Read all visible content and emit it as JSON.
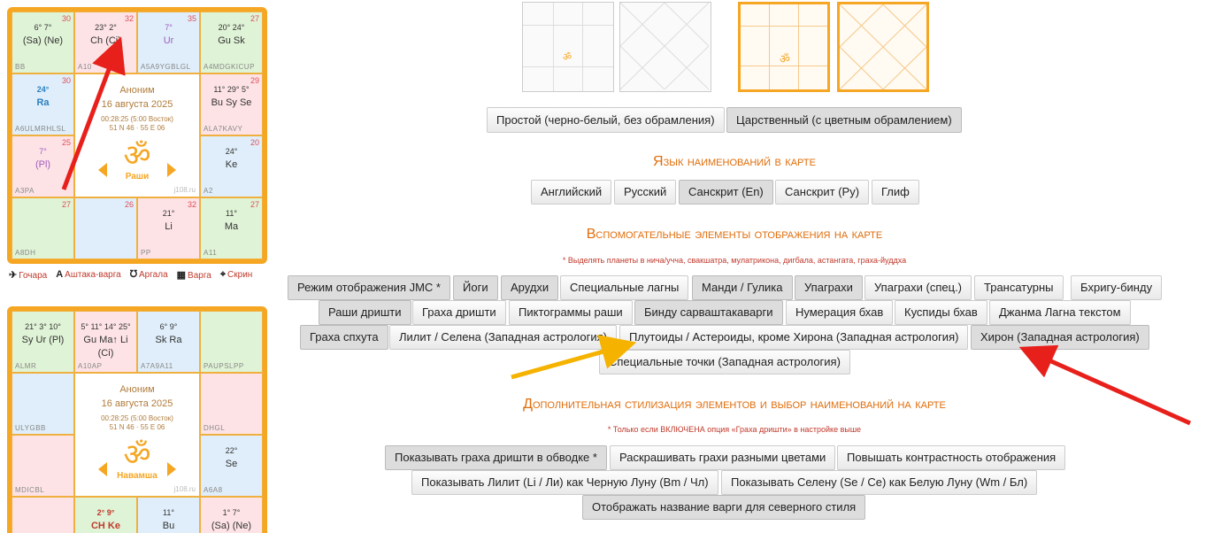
{
  "chart1": {
    "cells": [
      {
        "num": "30",
        "line1": "6° 7°",
        "line2": "(Sa) (Ne)",
        "foot": "BB",
        "bg": "g"
      },
      {
        "num": "32",
        "line1": "23° 2°",
        "line2": "Ch (Ci)",
        "foot": "A10",
        "bg": "p"
      },
      {
        "num": "35",
        "line1": "7°",
        "line2": "Ur",
        "foot": "A5A9YGBLGL",
        "bg": "b"
      },
      {
        "num": "27",
        "line1": "20° 24°",
        "line2": "Gu Sk",
        "foot": "A4MDGKICUP",
        "bg": "g"
      },
      {
        "num": "30",
        "line1": "24°",
        "line2": "Ra",
        "foot": "A6ULMRHLSL",
        "bg": "b"
      },
      {
        "num": "29",
        "line1": "11° 29° 5°",
        "line2": "Bu Sy Se",
        "foot": "ALA7KAVY",
        "bg": "p"
      },
      {
        "num": "25",
        "line1": "7°",
        "line2": "(Pl)",
        "foot": "A3PA",
        "bg": "p"
      },
      {
        "num": "20",
        "line1": "24°",
        "line2": "Ke",
        "foot": "A2",
        "bg": "b"
      },
      {
        "num": "27",
        "line1": "",
        "line2": "",
        "foot": "A8DH",
        "bg": "g"
      },
      {
        "num": "26",
        "line1": "",
        "line2": "",
        "foot": "",
        "bg": "b"
      },
      {
        "num": "32",
        "line1": "21°",
        "line2": "Li",
        "foot": "PP",
        "bg": "p"
      },
      {
        "num": "27",
        "line1": "11°",
        "line2": "Ma",
        "foot": "A11",
        "bg": "g"
      }
    ],
    "name": "Аноним",
    "date": "16 августа 2025",
    "time": "00:28:25 (5:00 Восток)",
    "coords": "51 N 46 · 55 E 06",
    "label": "Раши",
    "site": "j108.ru"
  },
  "chart2": {
    "cells": [
      {
        "num": "",
        "line1": "21° 3° 10°",
        "line2": "Sy Ur (Pl)",
        "foot": "ALMR",
        "bg": "g"
      },
      {
        "num": "",
        "line1": "5° 11° 14° 25°",
        "line2": "Gu Ma↑ Li (Ci)",
        "foot": "A10AP",
        "bg": "p"
      },
      {
        "num": "",
        "line1": "6° 9°",
        "line2": "Sk Ra",
        "foot": "A7A9A11",
        "bg": "b"
      },
      {
        "num": "",
        "line1": "",
        "line2": "",
        "foot": "PAUPSLPP",
        "bg": "g"
      },
      {
        "num": "",
        "line1": "",
        "line2": "",
        "foot": "ULYGBB",
        "bg": "b"
      },
      {
        "num": "",
        "line1": "",
        "line2": "",
        "foot": "DHGL",
        "bg": "p"
      },
      {
        "num": "",
        "line1": "",
        "line2": "",
        "foot": "MDICBL",
        "bg": "p"
      },
      {
        "num": "",
        "line1": "22°",
        "line2": "Se",
        "foot": "A6A8",
        "bg": "b"
      },
      {
        "num": "",
        "line1": "2° 9°",
        "line2": "CH Ke",
        "foot": "",
        "bg": "g"
      },
      {
        "num": "",
        "line1": "11°",
        "line2": "Bu",
        "foot": "",
        "bg": "b"
      },
      {
        "num": "",
        "line1": "1° 7°",
        "line2": "(Sa) (Ne)",
        "foot": "",
        "bg": "p"
      }
    ],
    "name": "Аноним",
    "date": "16 августа 2025",
    "time": "00:28:25 (5:00 Восток)",
    "coords": "51 N 46 · 55 E 06",
    "label": "Навамша",
    "site": "j108.ru"
  },
  "tools": [
    "Гочара",
    "Аштака-варга",
    "Аргала",
    "Варга",
    "Скрин"
  ],
  "style_buttons": [
    "Простой (черно-белый, без обрамления)",
    "Царственный (с цветным обрамлением)"
  ],
  "lang_title": "Язык наименований в карте",
  "lang_buttons": [
    "Английский",
    "Русский",
    "Санскрит (En)",
    "Санскрит (Ру)",
    "Глиф"
  ],
  "aux_title": "Вспомогательные элементы отображения на карте",
  "aux_note": "* Выделять планеты в нича/учча, свакшатра, мулатрикона, дигбала, астангата, граха-йуддха",
  "aux_buttons": [
    "Режим отображения JMC *",
    "Йоги",
    "Арудхи",
    "Специальные лагны",
    "Манди / Гулика",
    "Упаграхи",
    "Упаграхи (спец.)",
    "Трансатурны",
    "Бхригу-бинду",
    "Раши дришти",
    "Граха дришти",
    "Пиктограммы раши",
    "Бинду сарваштакаварги",
    "Нумерация бхав",
    "Куспиды бхав",
    "Джанма Лагна текстом",
    "Граха спхута",
    "Лилит / Селена (Западная астрология)",
    "Плутоиды / Астероиды, кроме Хирона (Западная астрология)",
    "Хирон (Западная астрология)",
    "Специальные точки (Западная астрология)"
  ],
  "extra_title": "Дополнительная стилизация элементов и выбор наименований на карте",
  "extra_note": "* Только если ВКЛЮЧЕНА опция «Граха дришти» в настройке выше",
  "extra_buttons": [
    "Показывать граха дришти в обводке *",
    "Раскрашивать грахи разными цветами",
    "Повышать контрастность отображения",
    "Показывать Лилит (Li / Ли) как Черную Луну (Bm / Чл)",
    "Показывать Селену (Se / Се) как Белую Луну (Wm / Бл)",
    "Отображать название варги для северного стиля"
  ],
  "colors": {
    "accent": "#f5a623",
    "heading": "#e06d0a",
    "arrow_red": "#e8201c",
    "arrow_yellow": "#f5b300"
  }
}
